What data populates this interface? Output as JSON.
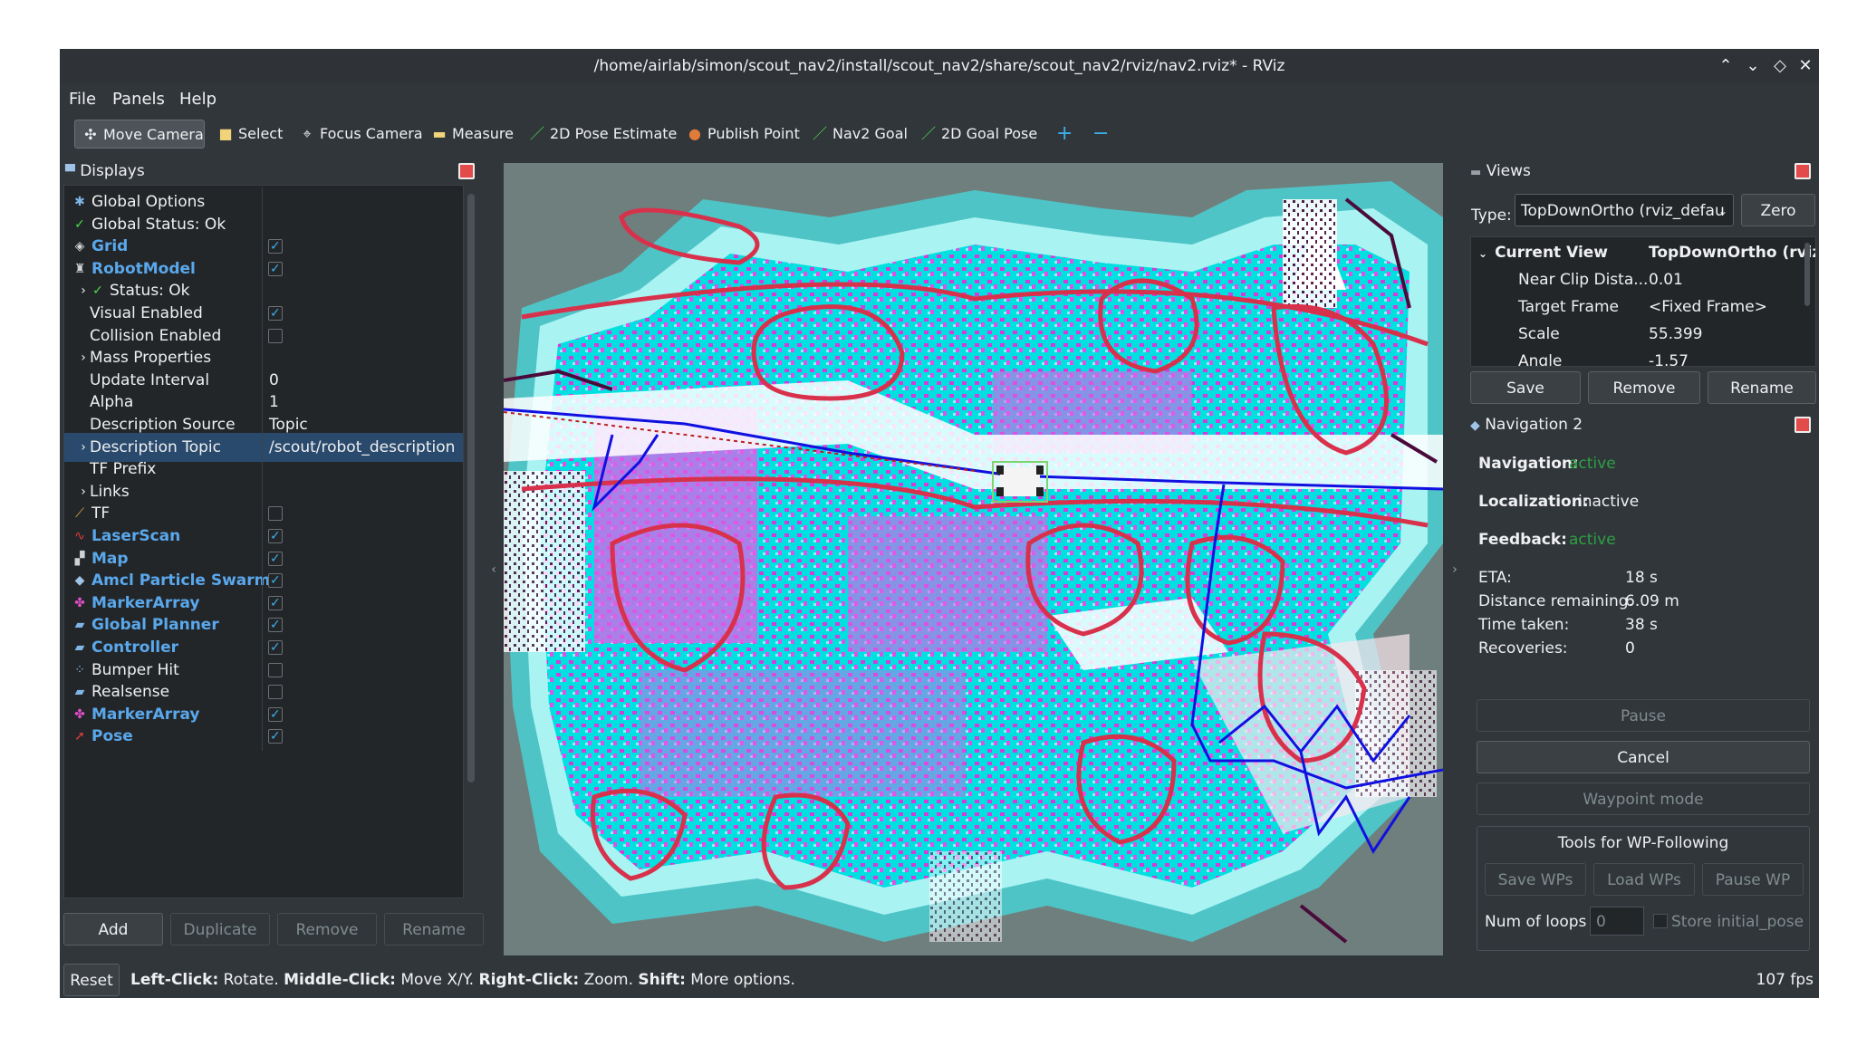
{
  "window": {
    "title": "/home/airlab/simon/scout_nav2/install/scout_nav2/share/scout_nav2/rviz/nav2.rviz* - RViz"
  },
  "menu": [
    "File",
    "Panels",
    "Help"
  ],
  "toolbar": {
    "tools": [
      "Move Camera",
      "Select",
      "Focus Camera",
      "Measure",
      "2D Pose Estimate",
      "Publish Point",
      "Nav2 Goal",
      "2D Goal Pose"
    ],
    "add_symbol": "+",
    "remove_symbol": "−"
  },
  "displays": {
    "title": "Displays",
    "rows": [
      {
        "name": "Global Options"
      },
      {
        "name": "Global Status: Ok"
      },
      {
        "name": "Grid",
        "checked": true
      },
      {
        "name": "RobotModel",
        "checked": true
      },
      {
        "name": "Status: Ok"
      },
      {
        "name": "Visual Enabled",
        "checked": true
      },
      {
        "name": "Collision Enabled",
        "checked": false
      },
      {
        "name": "Mass Properties"
      },
      {
        "name": "Update Interval",
        "value": "0"
      },
      {
        "name": "Alpha",
        "value": "1"
      },
      {
        "name": "Description Source",
        "value": "Topic"
      },
      {
        "name": "Description Topic",
        "value": "/scout/robot_description"
      },
      {
        "name": "TF Prefix"
      },
      {
        "name": "Links"
      },
      {
        "name": "TF",
        "checked": false
      },
      {
        "name": "LaserScan",
        "checked": true
      },
      {
        "name": "Map",
        "checked": true
      },
      {
        "name": "Amcl Particle Swarm",
        "checked": true
      },
      {
        "name": "MarkerArray",
        "checked": true
      },
      {
        "name": "Global Planner",
        "checked": true
      },
      {
        "name": "Controller",
        "checked": true
      },
      {
        "name": "Bumper Hit",
        "checked": false
      },
      {
        "name": "Realsense",
        "checked": false
      },
      {
        "name": "MarkerArray",
        "checked": true
      },
      {
        "name": "Pose",
        "checked": true
      }
    ],
    "buttons": [
      "Add",
      "Duplicate",
      "Remove",
      "Rename"
    ]
  },
  "views": {
    "title": "Views",
    "type_label": "Type:",
    "type_value": "TopDownOrtho (rviz_defau",
    "zero": "Zero",
    "current_view": "Current View",
    "current_view_value": "TopDownOrtho (rviz",
    "props": [
      {
        "name": "Near Clip Dista...",
        "value": "0.01"
      },
      {
        "name": "Target Frame",
        "value": "<Fixed Frame>"
      },
      {
        "name": "Scale",
        "value": "55.399"
      },
      {
        "name": "Angle",
        "value": "-1.57"
      }
    ],
    "buttons": [
      "Save",
      "Remove",
      "Rename"
    ]
  },
  "navigation": {
    "title": "Navigation 2",
    "nav_label": "Navigation:",
    "nav_value": "active",
    "loc_label": "Localization:",
    "loc_value": "inactive",
    "fb_label": "Feedback:",
    "fb_value": "active",
    "stats": [
      {
        "name": "ETA:",
        "value": "18 s"
      },
      {
        "name": "Distance remaining:",
        "value": "6.09 m"
      },
      {
        "name": "Time taken:",
        "value": "38 s"
      },
      {
        "name": "Recoveries:",
        "value": "0"
      }
    ],
    "pause": "Pause",
    "cancel": "Cancel",
    "waypoint": "Waypoint mode",
    "tools_title": "Tools for WP-Following",
    "save_wps": "Save WPs",
    "load_wps": "Load WPs",
    "pause_wp": "Pause WP",
    "loops_label": "Num of loops",
    "loops_value": "0",
    "store_label": "Store initial_pose"
  },
  "statusbar": {
    "reset": "Reset",
    "hint1_b": "Left-Click:",
    "hint1": " Rotate. ",
    "hint2_b": "Middle-Click:",
    "hint2": " Move X/Y. ",
    "hint3_b": "Right-Click:",
    "hint3": " Zoom. ",
    "hint4_b": "Shift:",
    "hint4": " More options.",
    "fps": "107 fps"
  },
  "colors": {
    "accent": "#3daee9",
    "active": "#2ea043",
    "map_bg": "#6f7f7d",
    "inflation": "#00e5e5",
    "obstacle": "#ff00ff",
    "path": "#0000ff"
  }
}
